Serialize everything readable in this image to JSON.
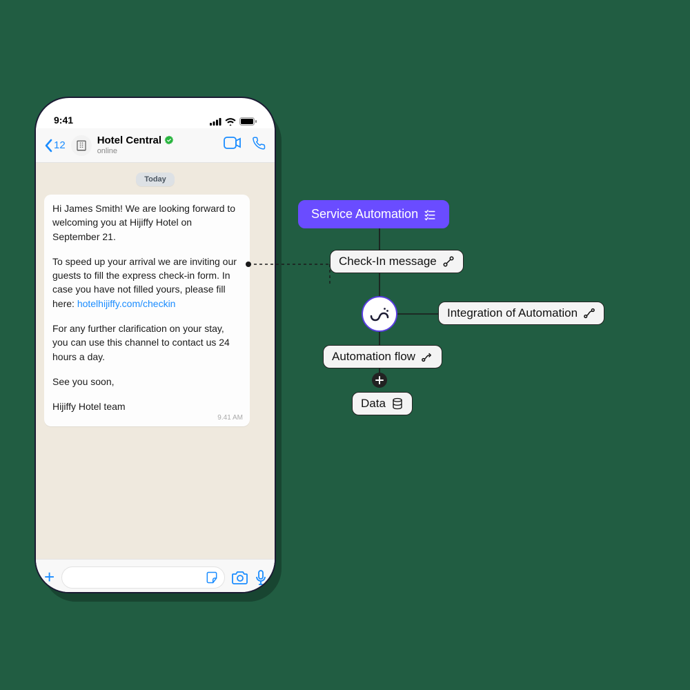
{
  "phone": {
    "time": "9:41",
    "back_count": "12",
    "contact_name": "Hotel Central",
    "status": "online",
    "date_chip": "Today",
    "msg_greeting": "Hi James Smith! We are looking forward to welcoming you at Hijiffy Hotel on September 21.",
    "msg_express_pre": "To speed up your arrival we are inviting our guests to fill the express check-in form. In case you have not filled yours, please fill here: ",
    "msg_link": "hotelhijiffy.com/checkin",
    "msg_channel": "For any further clarification on your stay, you can use this channel to contact us 24 hours a day.",
    "msg_seeyou": "See you soon,",
    "msg_team": "Hijiffy Hotel team",
    "msg_time": "9.41 AM"
  },
  "flow": {
    "service_automation": "Service Automation",
    "checkin_message": "Check-In message",
    "integration": "Integration of Automation",
    "automation_flow": "Automation flow",
    "data": "Data"
  }
}
